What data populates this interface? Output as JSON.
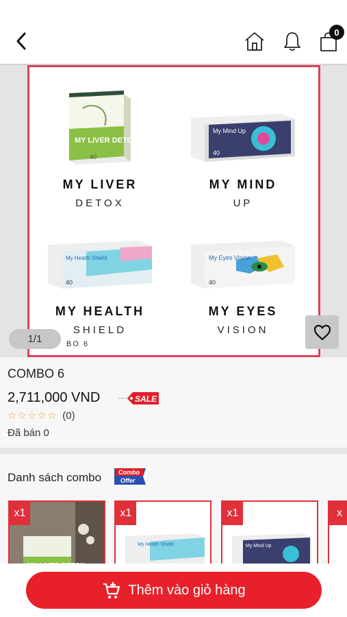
{
  "header": {
    "back_icon": "chevron-left-icon",
    "home_icon": "home-icon",
    "bell_icon": "bell-icon",
    "cart_icon": "shopping-bag-icon",
    "cart_count": "0"
  },
  "gallery": {
    "products": [
      {
        "name": "MY LIVER",
        "sub": "DETOX",
        "box_text": "MY LIVER DETOX",
        "box_count": "40"
      },
      {
        "name": "MY MIND",
        "sub": "UP",
        "box_text": "My Mind Up",
        "box_count": "40"
      },
      {
        "name": "MY HEALTH",
        "sub": "SHIELD",
        "box_text": "My Health Shield",
        "box_count": "40"
      },
      {
        "name": "MY EYES",
        "sub": "VISION",
        "box_text": "My Eyes Vision",
        "box_count": "40"
      }
    ],
    "tiny_label": "BO 6",
    "counter": "1/1",
    "frame_color": "#e0405a"
  },
  "product": {
    "title": "COMBO 6",
    "price": "2,711,000 VND",
    "sale_tag": "SALE",
    "rating_stars": 0,
    "rating_count": "(0)",
    "sold": "Đã bán 0"
  },
  "combo": {
    "title": "Danh sách combo",
    "badge_line1": "Combo",
    "badge_line2": "Offer",
    "items": [
      {
        "qty": "x1"
      },
      {
        "qty": "x1"
      },
      {
        "qty": "x1"
      },
      {
        "qty": "x"
      }
    ]
  },
  "bottom": {
    "add_to_cart": "Thêm vào giỏ hàng",
    "accent": "#e8202a"
  }
}
